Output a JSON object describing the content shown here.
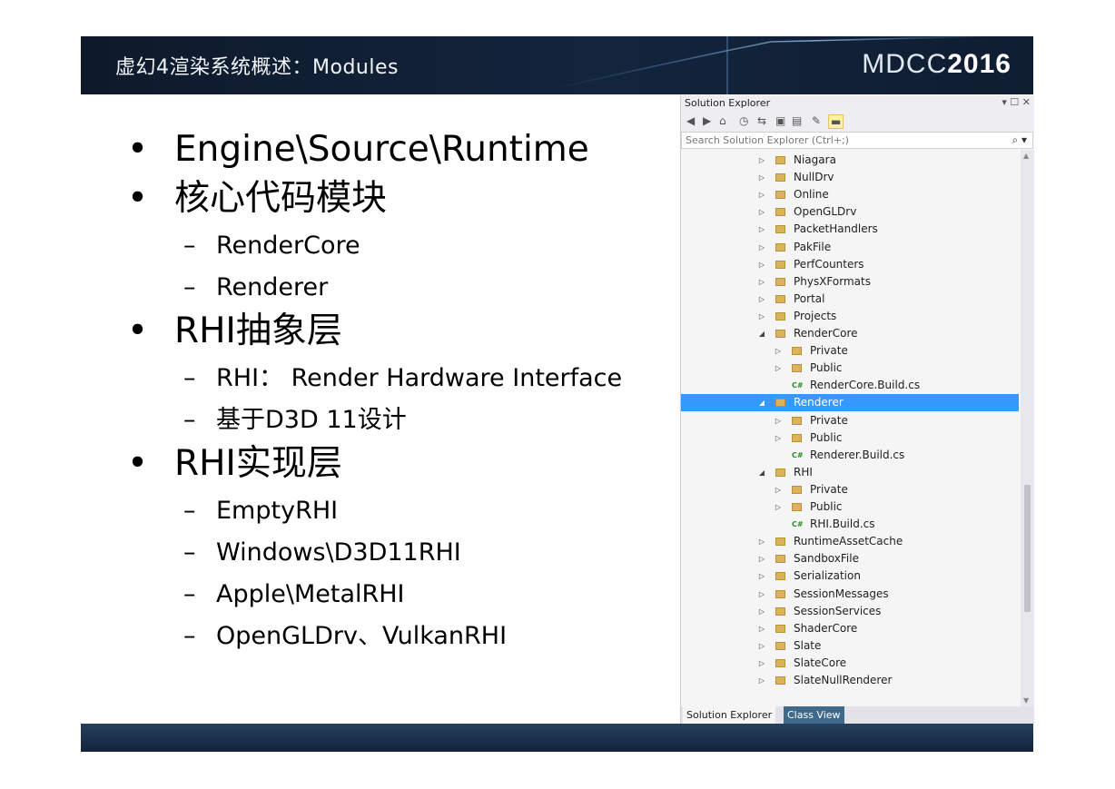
{
  "slide": {
    "title": "虚幻4渲染系统概述：Modules",
    "logo_text": "MDCC",
    "logo_year": "2016"
  },
  "bullets": [
    {
      "text": "Engine\\Source\\Runtime",
      "sub": []
    },
    {
      "text": "核心代码模块",
      "sub": [
        "RenderCore",
        "Renderer"
      ]
    },
    {
      "text": "RHI抽象层",
      "sub": [
        "RHI： Render Hardware Interface",
        "基于D3D 11设计"
      ]
    },
    {
      "text": "RHI实现层",
      "sub": [
        "EmptyRHI",
        "Windows\\D3D11RHI",
        "Apple\\MetalRHI",
        "OpenGLDrv、VulkanRHI"
      ]
    }
  ],
  "bullet_glyph": "•",
  "dash_glyph": "–",
  "solution_explorer": {
    "title": "Solution Explorer",
    "window_controls": "▾ ☐ ✕",
    "search_placeholder": "Search Solution Explorer (Ctrl+;)",
    "search_icon_glyph": "⌕ ▾",
    "tabs": [
      "Solution Explorer",
      "Class View"
    ],
    "tree": [
      {
        "label": "Niagara",
        "depth": 0,
        "state": "collapsed",
        "icon": "folder"
      },
      {
        "label": "NullDrv",
        "depth": 0,
        "state": "collapsed",
        "icon": "folder"
      },
      {
        "label": "Online",
        "depth": 0,
        "state": "collapsed",
        "icon": "folder"
      },
      {
        "label": "OpenGLDrv",
        "depth": 0,
        "state": "collapsed",
        "icon": "folder"
      },
      {
        "label": "PacketHandlers",
        "depth": 0,
        "state": "collapsed",
        "icon": "folder"
      },
      {
        "label": "PakFile",
        "depth": 0,
        "state": "collapsed",
        "icon": "folder"
      },
      {
        "label": "PerfCounters",
        "depth": 0,
        "state": "collapsed",
        "icon": "folder"
      },
      {
        "label": "PhysXFormats",
        "depth": 0,
        "state": "collapsed",
        "icon": "folder"
      },
      {
        "label": "Portal",
        "depth": 0,
        "state": "collapsed",
        "icon": "folder"
      },
      {
        "label": "Projects",
        "depth": 0,
        "state": "collapsed",
        "icon": "folder"
      },
      {
        "label": "RenderCore",
        "depth": 0,
        "state": "expanded",
        "icon": "folder"
      },
      {
        "label": "Private",
        "depth": 1,
        "state": "collapsed",
        "icon": "folder"
      },
      {
        "label": "Public",
        "depth": 1,
        "state": "collapsed",
        "icon": "folder"
      },
      {
        "label": "RenderCore.Build.cs",
        "depth": 1,
        "state": "none",
        "icon": "csharp"
      },
      {
        "label": "Renderer",
        "depth": 0,
        "state": "expanded",
        "icon": "folder",
        "selected": true
      },
      {
        "label": "Private",
        "depth": 1,
        "state": "collapsed",
        "icon": "folder"
      },
      {
        "label": "Public",
        "depth": 1,
        "state": "collapsed",
        "icon": "folder"
      },
      {
        "label": "Renderer.Build.cs",
        "depth": 1,
        "state": "none",
        "icon": "csharp"
      },
      {
        "label": "RHI",
        "depth": 0,
        "state": "expanded",
        "icon": "folder"
      },
      {
        "label": "Private",
        "depth": 1,
        "state": "collapsed",
        "icon": "folder"
      },
      {
        "label": "Public",
        "depth": 1,
        "state": "collapsed",
        "icon": "folder"
      },
      {
        "label": "RHI.Build.cs",
        "depth": 1,
        "state": "none",
        "icon": "csharp"
      },
      {
        "label": "RuntimeAssetCache",
        "depth": 0,
        "state": "collapsed",
        "icon": "folder"
      },
      {
        "label": "SandboxFile",
        "depth": 0,
        "state": "collapsed",
        "icon": "folder"
      },
      {
        "label": "Serialization",
        "depth": 0,
        "state": "collapsed",
        "icon": "folder"
      },
      {
        "label": "SessionMessages",
        "depth": 0,
        "state": "collapsed",
        "icon": "folder"
      },
      {
        "label": "SessionServices",
        "depth": 0,
        "state": "collapsed",
        "icon": "folder"
      },
      {
        "label": "ShaderCore",
        "depth": 0,
        "state": "collapsed",
        "icon": "folder"
      },
      {
        "label": "Slate",
        "depth": 0,
        "state": "collapsed",
        "icon": "folder"
      },
      {
        "label": "SlateCore",
        "depth": 0,
        "state": "collapsed",
        "icon": "folder"
      },
      {
        "label": "SlateNullRenderer",
        "depth": 0,
        "state": "collapsed",
        "icon": "folder"
      }
    ],
    "arrow_collapsed": "▷",
    "arrow_expanded": "◢",
    "csharp_glyph": "C#"
  },
  "colors": {
    "selection": "#3399ff",
    "header_bg": "#0e1a2b",
    "folder": "#dcb25b"
  }
}
